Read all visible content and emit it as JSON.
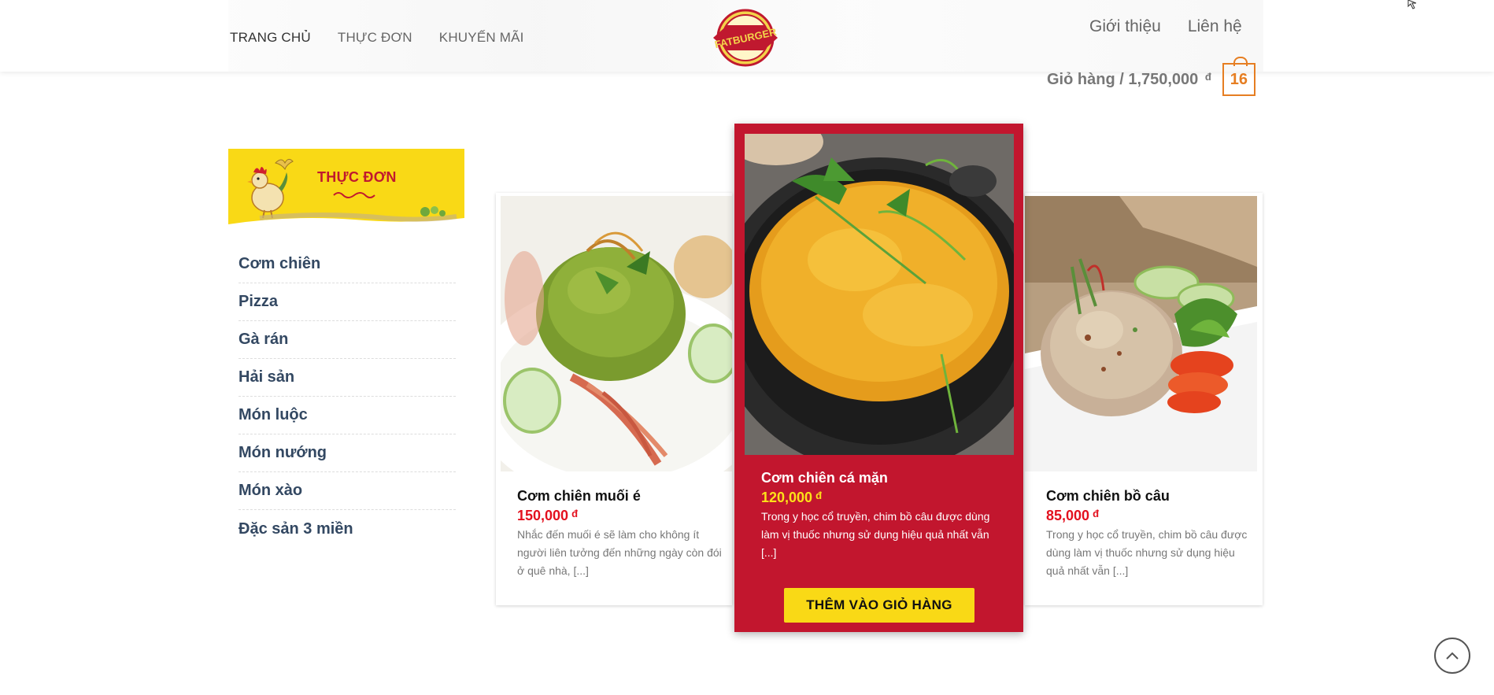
{
  "nav": {
    "left": [
      "TRANG CHỦ",
      "THỰC ĐƠN",
      "KHUYẾN MÃI"
    ],
    "right": [
      "Giới thiệu",
      "Liên hệ"
    ],
    "logo_text": "FATBURGER"
  },
  "cart": {
    "label": "Giỏ hàng / 1,750,000",
    "currency": "đ",
    "count": "16"
  },
  "sidebar": {
    "title": "THỰC ĐƠN",
    "items": [
      "Cơm chiên",
      "Pizza",
      "Gà rán",
      "Hải sản",
      "Món luộc",
      "Món nướng",
      "Món xào",
      "Đặc sản 3 miền"
    ]
  },
  "products": [
    {
      "name": "Cơm chiên muối é",
      "price": "150,000",
      "currency": "đ",
      "desc": "Nhắc đến muối é sẽ làm cho không ít người liên tưởng đến những ngày còn đói ở quê nhà, [...]"
    },
    {
      "name": "Cơm chiên cá mặn",
      "price": "120,000",
      "currency": "đ",
      "desc": "Trong y học cổ truyền, chim bồ câu được dùng làm vị thuốc nhưng sử dụng hiệu quả nhất vẫn [...]",
      "button": "THÊM VÀO GIỎ HÀNG"
    },
    {
      "name": "Cơm chiên bồ câu",
      "price": "85,000",
      "currency": "đ",
      "desc": "Trong y học cổ truyền, chim bồ câu được dùng làm vị thuốc nhưng sử dụng hiệu quả nhất vẫn [...]"
    }
  ],
  "colors": {
    "accent_red": "#c2162e",
    "accent_yellow": "#f9d916",
    "price_red": "#e3101e",
    "cart_orange": "#e67e22",
    "menu_text": "#334862"
  }
}
